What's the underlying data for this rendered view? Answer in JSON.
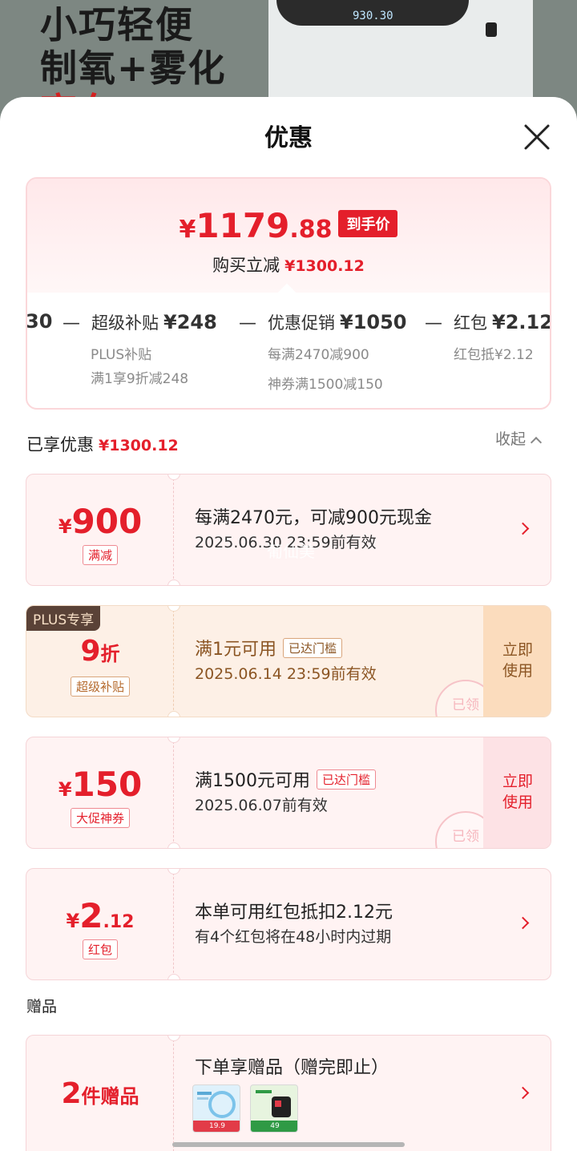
{
  "banner": {
    "line1": "小巧轻便",
    "line2": "制氧+雾化",
    "line3": "高车",
    "display": "930.30"
  },
  "sheet": {
    "title": "优惠",
    "close_icon": "close-icon"
  },
  "summary": {
    "currency": "¥",
    "price_int": "1179",
    "price_dec": ".88",
    "price_tag": "到手价",
    "reduce_label": "购买立减",
    "reduce_amount": "¥1300.12",
    "breakdown": [
      {
        "name": "",
        "amount": "30",
        "subs": []
      },
      {
        "name": "超级补贴",
        "amount": "¥248",
        "subs": [
          "PLUS补贴",
          "满1享9折减248"
        ]
      },
      {
        "name": "优惠促销",
        "amount": "¥1050",
        "subs": [
          "每满2470减900",
          "神券满1500减150"
        ]
      },
      {
        "name": "红包",
        "amount": "¥2.12",
        "subs": [
          "红包抵¥2.12"
        ]
      }
    ],
    "minus": "—"
  },
  "enjoyed": {
    "label": "已享优惠",
    "amount": "¥1300.12",
    "collapse": "收起"
  },
  "coupons": [
    {
      "symbol": "¥",
      "value": "900",
      "label": "满减",
      "desc1": "每满2470元，可减900元现金",
      "desc2": "2025.06.30 23:59前有效",
      "watermark": "葡仙美"
    },
    {
      "badge": "PLUS专享",
      "value": "9",
      "unit": "折",
      "label": "超级补贴",
      "desc1": "满1元可用",
      "met": "已达门槛",
      "desc2": "2025.06.14 23:59前有效",
      "action": "立即使用",
      "stamp": "已领"
    },
    {
      "symbol": "¥",
      "value": "150",
      "label": "大促神券",
      "desc1": "满1500元可用",
      "met": "已达门槛",
      "desc2": "2025.06.07前有效",
      "action": "立即使用",
      "stamp": "已领"
    },
    {
      "symbol": "¥",
      "value": "2",
      "value_small": ".12",
      "label": "红包",
      "desc1": "本单可用红包抵扣2.12元",
      "desc2": "有4个红包将在48小时内过期"
    }
  ],
  "gifts": {
    "section_title": "赠品",
    "count": "2",
    "count_label": "件赠品",
    "desc": "下单享赠品（赠完即止）",
    "thumb_prices": [
      "19.9",
      "49"
    ]
  },
  "colors": {
    "accent": "#e41f2b",
    "plus_badge": "#5a4237",
    "gold_text": "#8b5523"
  }
}
